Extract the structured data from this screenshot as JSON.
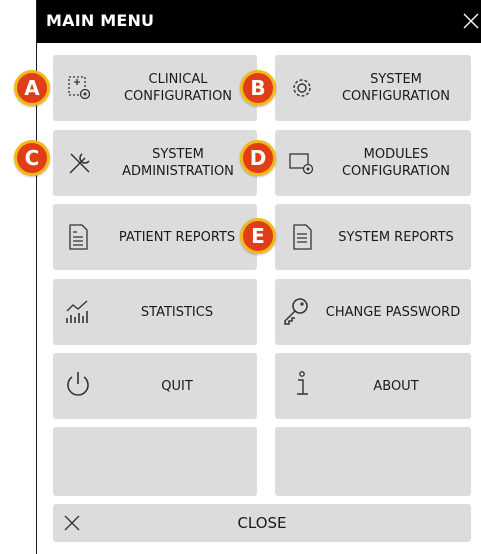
{
  "menu": {
    "title": "MAIN MENU",
    "tiles": [
      {
        "label": "CLINICAL\nCONFIGURATION",
        "icon": "clinical-config-icon",
        "badge": "A"
      },
      {
        "label": "SYSTEM\nCONFIGURATION",
        "icon": "system-config-gear-icon",
        "badge": "B"
      },
      {
        "label": "SYSTEM\nADMINISTRATION",
        "icon": "wrench-screwdriver-icon",
        "badge": "C"
      },
      {
        "label": "MODULES\nCONFIGURATION",
        "icon": "modules-config-icon",
        "badge": "D"
      },
      {
        "label": "PATIENT REPORTS",
        "icon": "patient-report-icon",
        "badge": ""
      },
      {
        "label": "SYSTEM REPORTS",
        "icon": "system-report-icon",
        "badge": "E"
      },
      {
        "label": "STATISTICS",
        "icon": "statistics-icon",
        "badge": ""
      },
      {
        "label": "CHANGE PASSWORD",
        "icon": "key-icon",
        "badge": ""
      },
      {
        "label": "QUIT",
        "icon": "power-icon",
        "badge": ""
      },
      {
        "label": "ABOUT",
        "icon": "info-icon",
        "badge": ""
      },
      {
        "label": "",
        "icon": "",
        "badge": ""
      },
      {
        "label": "",
        "icon": "",
        "badge": ""
      }
    ],
    "close_label": "CLOSE"
  },
  "colors": {
    "titlebar": "#000000",
    "tile": "#dcdcdc",
    "badge_fill": "#e03e16",
    "badge_ring": "#f3b917"
  }
}
